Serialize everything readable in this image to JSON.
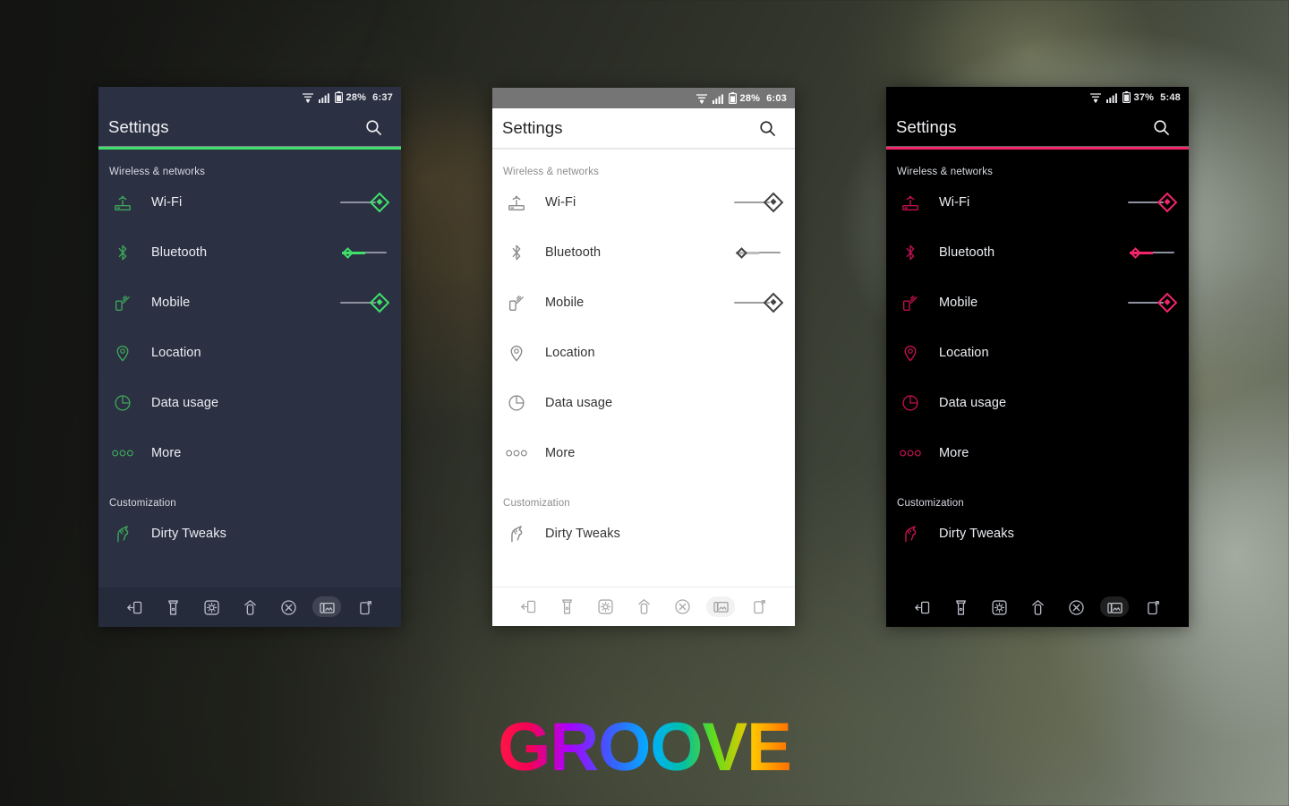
{
  "wallpaper": {
    "description": "blurred dark foliage photograph",
    "tone_dark": "#23251f",
    "tone_light": "#8d9488"
  },
  "brand": {
    "logo_text": "GROOVE",
    "gradient_stops": [
      "#FF1744",
      "#F50057",
      "#AA00FF",
      "#3D5AFE",
      "#00B0FF",
      "#00BFA5",
      "#64DD17",
      "#FFC400",
      "#FF6D00"
    ]
  },
  "panels": [
    {
      "id": "dark-theme-panel",
      "theme_name": "dark",
      "accent_color": "#3EE06A",
      "background_color": "#2B3042",
      "statusbar": {
        "battery": "28%",
        "time": "6:37",
        "icons": [
          "wifi-icon",
          "signal-icon",
          "battery-icon"
        ]
      },
      "actionbar": {
        "title": "Settings",
        "search_icon": "search-icon"
      },
      "sections": [
        {
          "header": "Wireless & networks",
          "rows": [
            {
              "label": "Wi-Fi",
              "icon": "router-icon",
              "toggle": "on"
            },
            {
              "label": "Bluetooth",
              "icon": "bluetooth-icon",
              "toggle": "off"
            },
            {
              "label": "Mobile",
              "icon": "mobile-data-icon",
              "toggle": "on"
            },
            {
              "label": "Location",
              "icon": "location-pin-icon",
              "toggle": null
            },
            {
              "label": "Data usage",
              "icon": "pie-chart-icon",
              "toggle": null
            },
            {
              "label": "More",
              "icon": "more-dots-icon",
              "toggle": null
            }
          ]
        },
        {
          "header": "Customization",
          "rows": [
            {
              "label": "Dirty Tweaks",
              "icon": "unicorn-icon",
              "toggle": null
            }
          ]
        }
      ],
      "navbar": [
        "back-icon",
        "flashlight-icon",
        "settings-gear-icon",
        "home-icon",
        "close-circle-icon",
        "screenshot-icon",
        "recents-icon"
      ],
      "navbar_highlighted_index": 5
    },
    {
      "id": "light-theme-panel",
      "theme_name": "light",
      "accent_color": "#424242",
      "background_color": "#FFFFFF",
      "statusbar": {
        "battery": "28%",
        "time": "6:03",
        "icons": [
          "wifi-icon",
          "signal-icon",
          "battery-icon"
        ]
      },
      "actionbar": {
        "title": "Settings",
        "search_icon": "search-icon"
      },
      "sections": [
        {
          "header": "Wireless & networks",
          "rows": [
            {
              "label": "Wi-Fi",
              "icon": "router-icon",
              "toggle": "on"
            },
            {
              "label": "Bluetooth",
              "icon": "bluetooth-icon",
              "toggle": "off"
            },
            {
              "label": "Mobile",
              "icon": "mobile-data-icon",
              "toggle": "on"
            },
            {
              "label": "Location",
              "icon": "location-pin-icon",
              "toggle": null
            },
            {
              "label": "Data usage",
              "icon": "pie-chart-icon",
              "toggle": null
            },
            {
              "label": "More",
              "icon": "more-dots-icon",
              "toggle": null
            }
          ]
        },
        {
          "header": "Customization",
          "rows": [
            {
              "label": "Dirty Tweaks",
              "icon": "unicorn-icon",
              "toggle": null
            }
          ]
        }
      ],
      "navbar": [
        "back-icon",
        "flashlight-icon",
        "settings-gear-icon",
        "home-icon",
        "close-circle-icon",
        "screenshot-icon",
        "recents-icon"
      ],
      "navbar_highlighted_index": 5
    },
    {
      "id": "black-theme-panel",
      "theme_name": "black",
      "accent_color": "#F2256A",
      "background_color": "#000000",
      "statusbar": {
        "battery": "37%",
        "time": "5:48",
        "icons": [
          "wifi-icon",
          "signal-icon",
          "battery-icon"
        ]
      },
      "actionbar": {
        "title": "Settings",
        "search_icon": "search-icon"
      },
      "sections": [
        {
          "header": "Wireless & networks",
          "rows": [
            {
              "label": "Wi-Fi",
              "icon": "router-icon",
              "toggle": "on"
            },
            {
              "label": "Bluetooth",
              "icon": "bluetooth-icon",
              "toggle": "off"
            },
            {
              "label": "Mobile",
              "icon": "mobile-data-icon",
              "toggle": "on"
            },
            {
              "label": "Location",
              "icon": "location-pin-icon",
              "toggle": null
            },
            {
              "label": "Data usage",
              "icon": "pie-chart-icon",
              "toggle": null
            },
            {
              "label": "More",
              "icon": "more-dots-icon",
              "toggle": null
            }
          ]
        },
        {
          "header": "Customization",
          "rows": [
            {
              "label": "Dirty Tweaks",
              "icon": "unicorn-icon",
              "toggle": null
            }
          ]
        }
      ],
      "navbar": [
        "back-icon",
        "flashlight-icon",
        "settings-gear-icon",
        "home-icon",
        "close-circle-icon",
        "screenshot-icon",
        "recents-icon"
      ],
      "navbar_highlighted_index": 5
    }
  ]
}
